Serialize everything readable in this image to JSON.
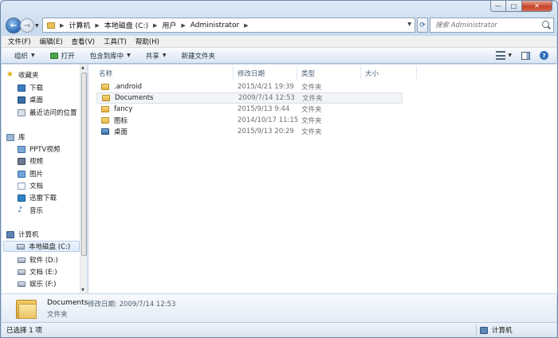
{
  "window": {
    "caption_min": "—",
    "caption_max": "□",
    "caption_close": "✕"
  },
  "nav": {
    "back": "←",
    "forward": "→"
  },
  "address": {
    "segments": [
      "计算机",
      "本地磁盘 (C:)",
      "用户",
      "Administrator"
    ],
    "separator": "▶"
  },
  "search": {
    "placeholder": "搜索 Administrator"
  },
  "menu": [
    "文件(F)",
    "编辑(E)",
    "查看(V)",
    "工具(T)",
    "帮助(H)"
  ],
  "toolbar": {
    "organize": "组织",
    "open": "打开",
    "include_in_library": "包含到库中",
    "share": "共享",
    "new_folder": "新建文件夹",
    "help": "?"
  },
  "sidebar": {
    "favorites": {
      "label": "收藏夹",
      "items": [
        "下载",
        "桌面",
        "最近访问的位置"
      ]
    },
    "libraries": {
      "label": "库",
      "items": [
        "PPTV视频",
        "视频",
        "图片",
        "文档",
        "迅雷下载",
        "音乐"
      ]
    },
    "computer": {
      "label": "计算机",
      "items": [
        "本地磁盘 (C:)",
        "软件 (D:)",
        "文档 (E:)",
        "娱乐 (F:)"
      ]
    }
  },
  "columns": [
    "名称",
    "修改日期",
    "类型",
    "大小"
  ],
  "files": [
    {
      "name": ".android",
      "date": "2015/4/21 19:39",
      "type": "文件夹"
    },
    {
      "name": "Documents",
      "date": "2009/7/14 12:53",
      "type": "文件夹"
    },
    {
      "name": "fancy",
      "date": "2015/9/13 9:44",
      "type": "文件夹"
    },
    {
      "name": "图标",
      "date": "2014/10/17 11:15",
      "type": "文件夹"
    },
    {
      "name": "桌面",
      "date": "2015/9/13 20:29",
      "type": "文件夹"
    }
  ],
  "details": {
    "name": "Documents",
    "meta": "修改日期: 2009/7/14 12:53",
    "type": "文件夹"
  },
  "status": {
    "selected": "已选择 1 项",
    "location": "计算机"
  },
  "colors": {
    "accent": "#2f6bb4",
    "folder": "#e2b448",
    "selection_border": "#b6cee9"
  },
  "icons": {
    "favorites": "star-icon",
    "libraries": "library-icon",
    "computer": "computer-icon",
    "folder": "folder-icon",
    "search": "search-icon",
    "refresh": "refresh-icon"
  }
}
